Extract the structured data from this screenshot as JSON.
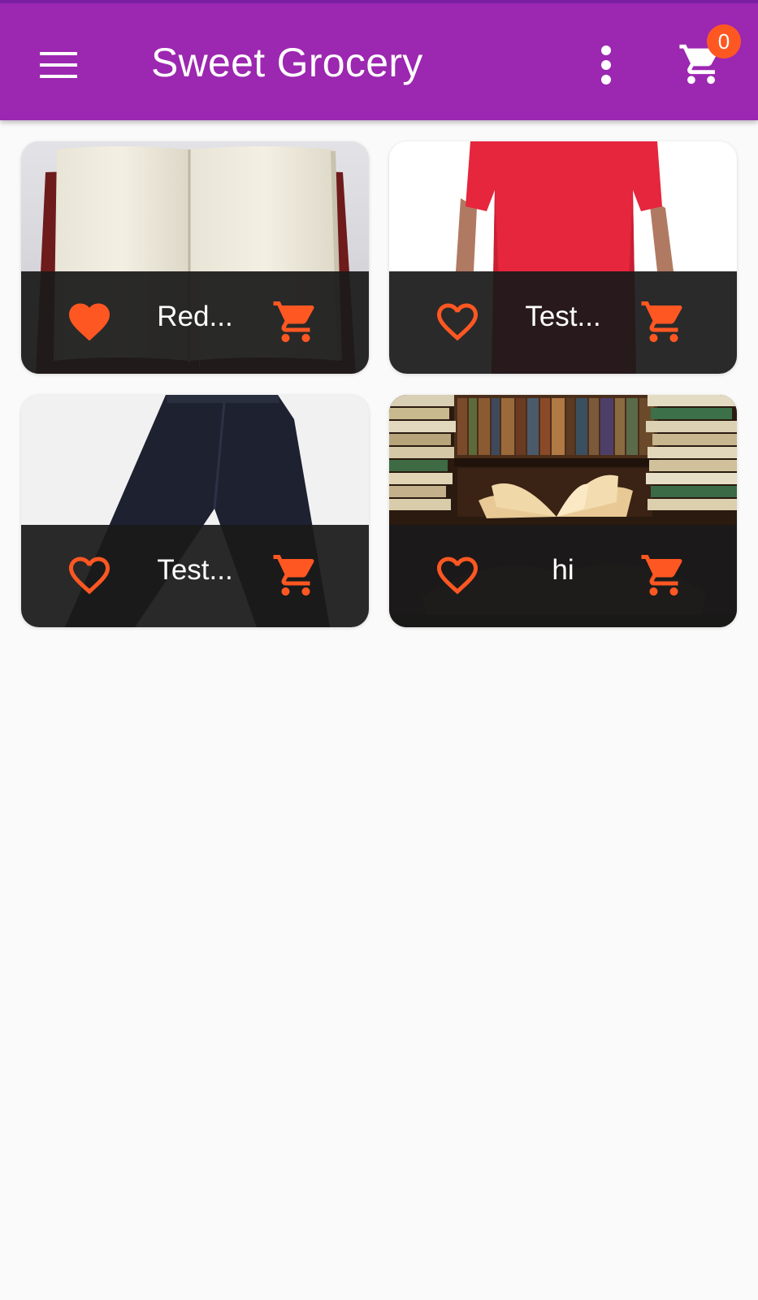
{
  "app_bar": {
    "title": "Sweet Grocery",
    "background_color": "#9c27b0",
    "menu_icon": "hamburger-menu-icon",
    "overflow_icon": "more-vert-icon",
    "cart_icon": "shopping-cart-icon",
    "cart_badge_count": "0",
    "badge_color": "#ff5722"
  },
  "accent_color": "#ff5722",
  "products": [
    {
      "name": "Red...",
      "image_subject": "open book with blank pages",
      "favorite": true,
      "favorite_icon": "heart-filled-icon",
      "cart_icon": "add-shopping-cart-icon"
    },
    {
      "name": "Test...",
      "image_subject": "red t-shirt",
      "favorite": false,
      "favorite_icon": "heart-outline-icon",
      "cart_icon": "add-shopping-cart-icon"
    },
    {
      "name": "Test...",
      "image_subject": "dark trousers",
      "favorite": false,
      "favorite_icon": "heart-outline-icon",
      "cart_icon": "add-shopping-cart-icon"
    },
    {
      "name": "hi",
      "image_subject": "books in a library",
      "favorite": false,
      "favorite_icon": "heart-outline-icon",
      "cart_icon": "add-shopping-cart-icon"
    }
  ]
}
